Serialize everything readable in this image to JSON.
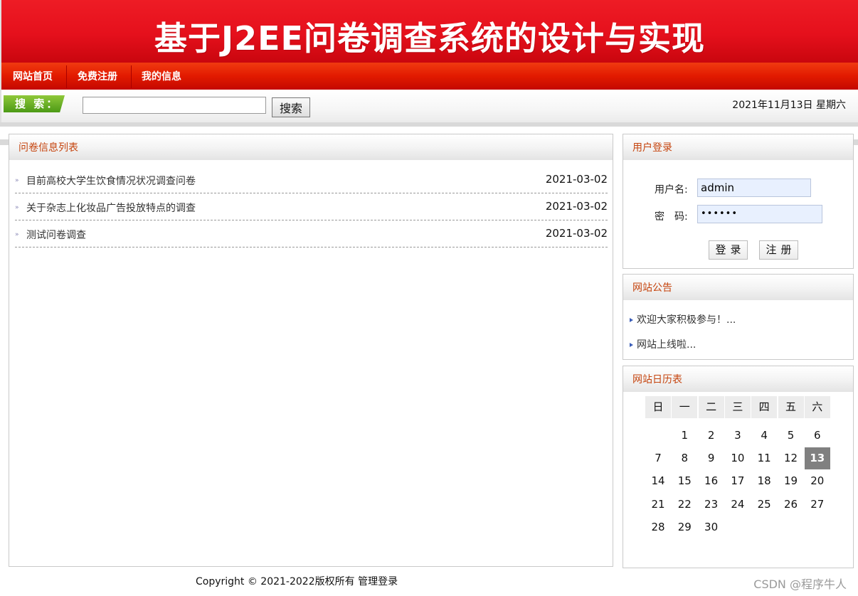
{
  "banner": {
    "title": "基于J2EE问卷调查系统的设计与实现"
  },
  "nav": {
    "items": [
      "网站首页",
      "免费注册",
      "我的信息"
    ]
  },
  "search": {
    "tag": "搜 索：",
    "value": "",
    "button": "搜索",
    "date": "2021年11月13日 星期六"
  },
  "survey_list": {
    "title": "问卷信息列表",
    "items": [
      {
        "title": "目前高校大学生饮食情况状况调查问卷",
        "date": "2021-03-02"
      },
      {
        "title": "关于杂志上化妆品广告投放特点的调查",
        "date": "2021-03-02"
      },
      {
        "title": "测试问卷调查",
        "date": "2021-03-02"
      }
    ]
  },
  "login": {
    "title": "用户登录",
    "username_label": "用户名:",
    "password_label": "密　码:",
    "username_value": "admin",
    "password_value": "••••••",
    "login_button": "登录",
    "register_button": "注册"
  },
  "notices": {
    "title": "网站公告",
    "items": [
      "欢迎大家积极参与！...",
      "网站上线啦..."
    ]
  },
  "calendar": {
    "title": "网站日历表",
    "weekdays": [
      "日",
      "一",
      "二",
      "三",
      "四",
      "五",
      "六"
    ],
    "weeks": [
      [
        "",
        "1",
        "2",
        "3",
        "4",
        "5",
        "6"
      ],
      [
        "7",
        "8",
        "9",
        "10",
        "11",
        "12",
        "13"
      ],
      [
        "14",
        "15",
        "16",
        "17",
        "18",
        "19",
        "20"
      ],
      [
        "21",
        "22",
        "23",
        "24",
        "25",
        "26",
        "27"
      ],
      [
        "28",
        "29",
        "30",
        "",
        "",
        "",
        ""
      ]
    ],
    "today": "13"
  },
  "footer": {
    "copyright": "Copyright © 2021-2022版权所有 管理登录"
  },
  "watermark": "CSDN @程序牛人",
  "colors": {
    "banner_red": "#e5101c",
    "panel_title": "#c5440e",
    "search_tag_green": "#5aa81e",
    "today_bg": "#808080"
  }
}
